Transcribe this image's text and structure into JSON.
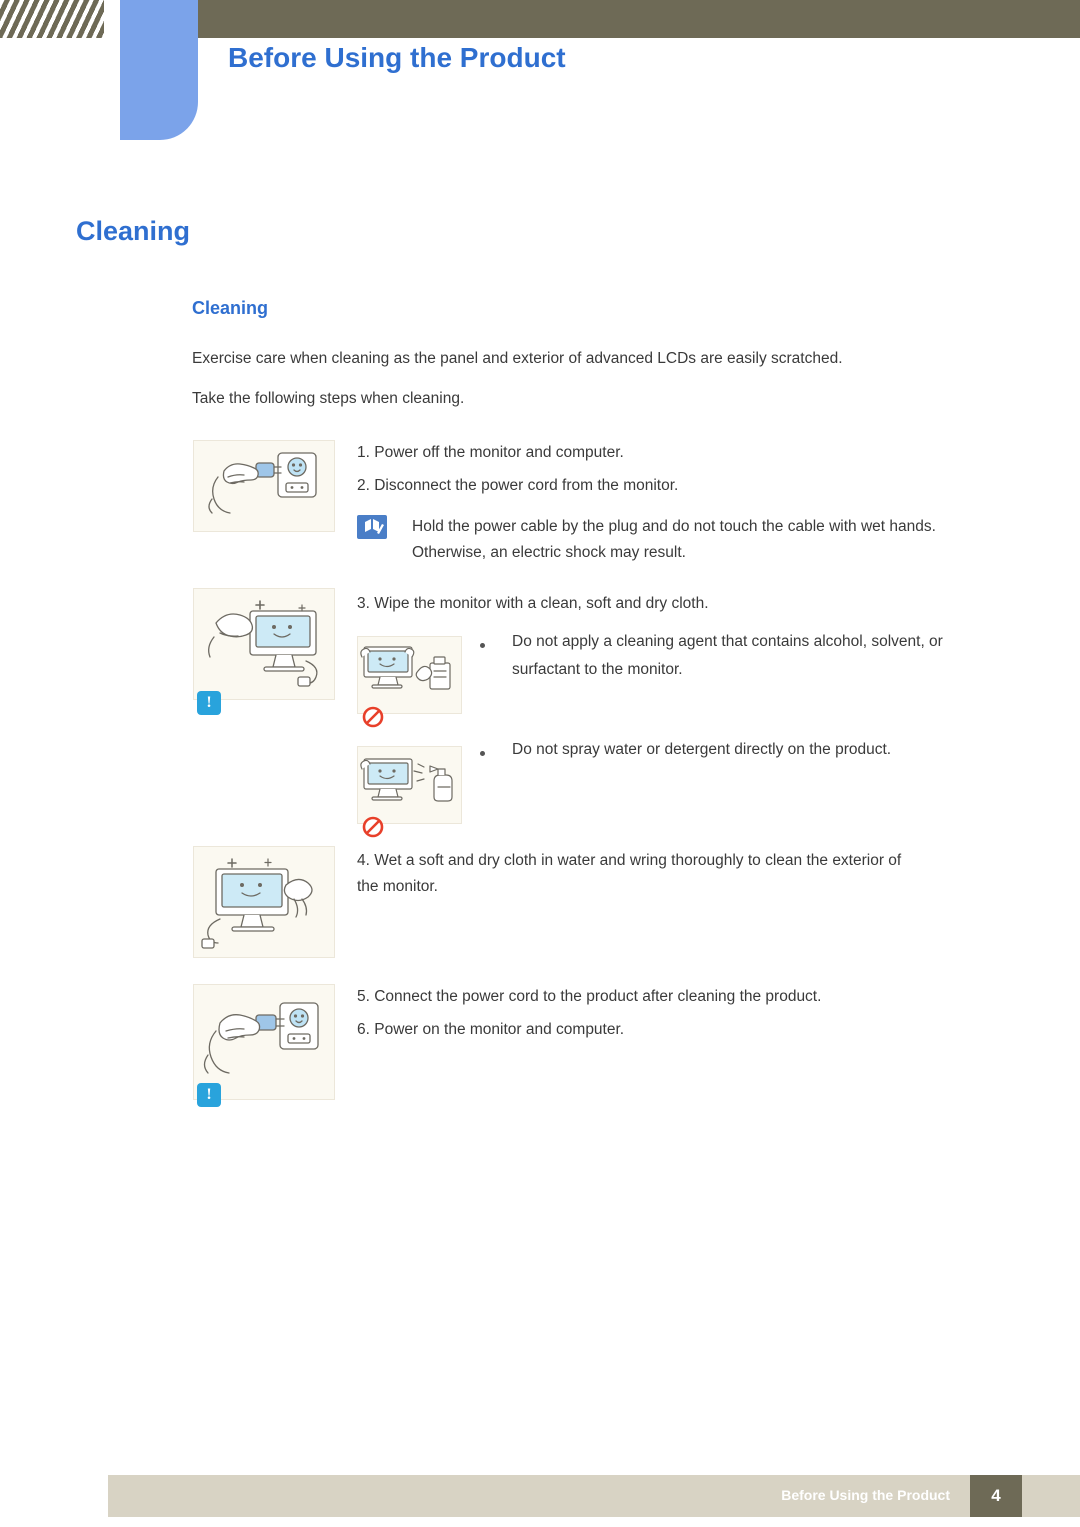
{
  "header": {
    "title": "Before Using the Product"
  },
  "chapter": {
    "title": "Cleaning"
  },
  "section": {
    "title": "Cleaning"
  },
  "paragraphs": {
    "intro_1": "Exercise care when cleaning as the panel and exterior of advanced LCDs are easily scratched.",
    "intro_2": "Take the following steps when cleaning."
  },
  "steps": [
    "1. Power off the monitor and computer.",
    "2. Disconnect the power cord from the monitor.",
    "3. Wipe the monitor with a clean, soft and dry cloth.",
    "4. Wet a soft and dry cloth in water and wring thoroughly to clean the exterior of the monitor.",
    "5. Connect the power cord to the product after cleaning the product.",
    "6. Power on the monitor and computer."
  ],
  "note": {
    "icon": "note-pencil-icon",
    "text": "Hold the power cable by the plug and do not touch the cable with wet hands. Otherwise, an electric shock may result."
  },
  "bullets": [
    "Do not apply a cleaning agent that contains alcohol, solvent, or surfactant to the monitor.",
    "Do not spray water or detergent directly on the product."
  ],
  "illustrations": [
    {
      "name": "unplug-power-cord-illustration",
      "badge": ""
    },
    {
      "name": "wipe-monitor-illustration",
      "badge": "!"
    },
    {
      "name": "no-alcohol-cleaner-illustration",
      "badge": "prohibited"
    },
    {
      "name": "no-spray-water-illustration",
      "badge": "prohibited"
    },
    {
      "name": "wet-cloth-exterior-illustration",
      "badge": ""
    },
    {
      "name": "connect-power-cord-illustration",
      "badge": "!"
    }
  ],
  "badges": {
    "warning": "!"
  },
  "footer": {
    "label": "Before Using the Product",
    "page": "4"
  },
  "colors": {
    "accent_blue": "#2f6fd0",
    "tab_blue": "#7ba3ea",
    "header_olive": "#6e6a56",
    "footer_beige": "#d8d3c4",
    "illus_bg": "#fbf9f1",
    "badge_blue": "#29a3dc"
  }
}
